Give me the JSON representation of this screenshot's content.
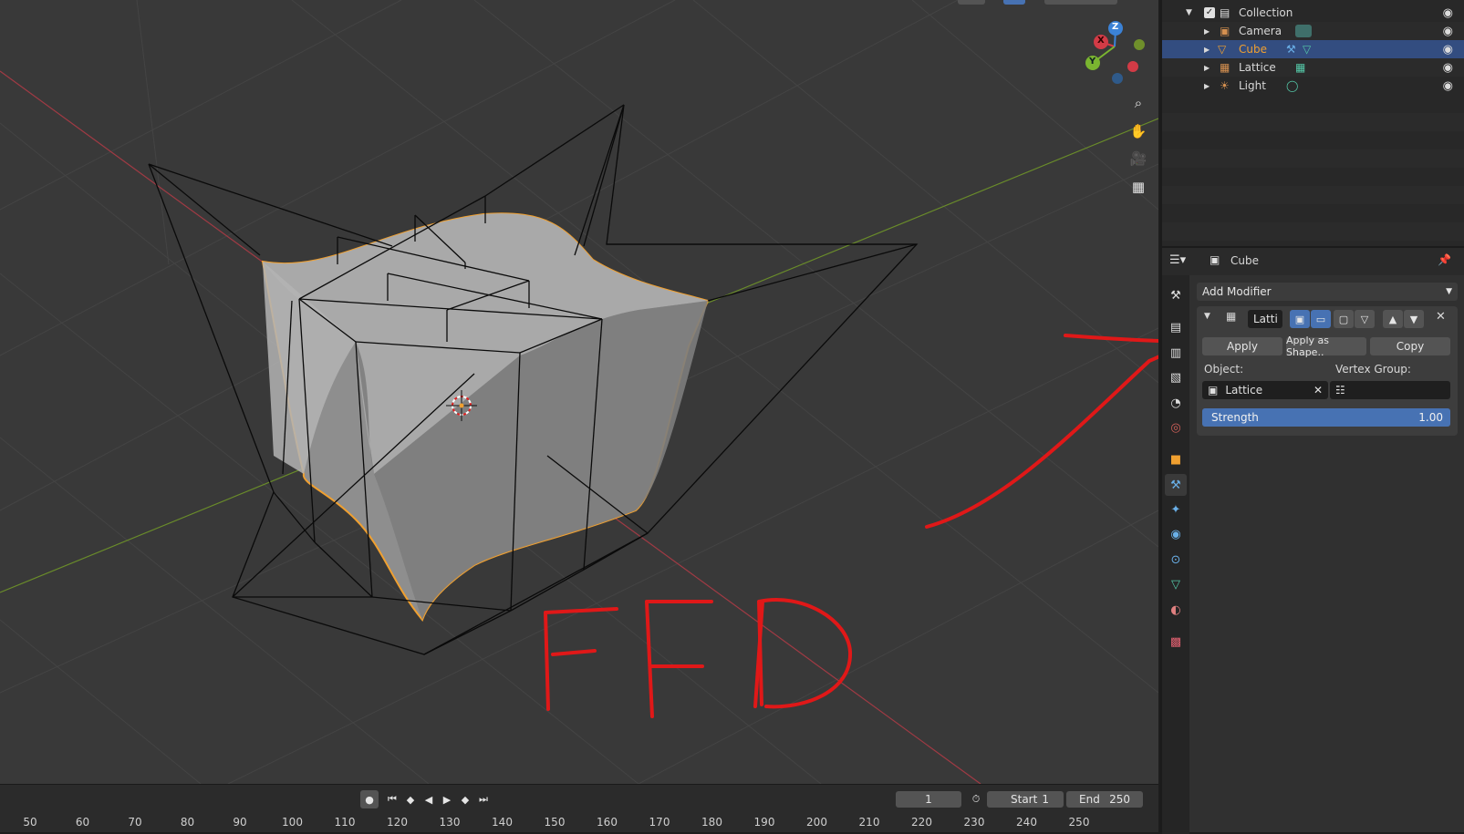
{
  "outliner": {
    "items": [
      {
        "label": "Collection",
        "type": "collection"
      },
      {
        "label": "Camera",
        "type": "camera"
      },
      {
        "label": "Cube",
        "type": "mesh",
        "selected": true
      },
      {
        "label": "Lattice",
        "type": "lattice"
      },
      {
        "label": "Light",
        "type": "light"
      }
    ],
    "eye_icon": "eye-icon"
  },
  "properties": {
    "header_object": "Cube",
    "add_modifier_label": "Add Modifier",
    "modifier": {
      "name": "Latti",
      "apply_label": "Apply",
      "apply_shape_label": "Apply as Shape..",
      "copy_label": "Copy",
      "object_label": "Object:",
      "object_value": "Lattice",
      "vertex_group_label": "Vertex Group:",
      "strength_label": "Strength",
      "strength_value": "1.00",
      "strength_fraction": 1.0
    }
  },
  "timeline": {
    "current_frame": "1",
    "start_label": "Start",
    "start_value": "1",
    "end_label": "End",
    "end_value": "250",
    "ruler_ticks": [
      "50",
      "60",
      "70",
      "80",
      "90",
      "100",
      "110",
      "120",
      "130",
      "140",
      "150",
      "160",
      "170",
      "180",
      "190",
      "200",
      "210",
      "220",
      "230",
      "240",
      "250"
    ]
  },
  "gizmo": {
    "x_label": "X",
    "y_label": "Y",
    "z_label": "Z"
  },
  "annotation": {
    "text": "FFD"
  },
  "colors": {
    "selection_outline": "#f0a030",
    "selected_row": "#334d80",
    "active_button": "#4772b3",
    "annotation": "#e01818",
    "x_axis": "#d23b46",
    "y_axis": "#7ab530",
    "z_axis": "#3b82d6"
  }
}
